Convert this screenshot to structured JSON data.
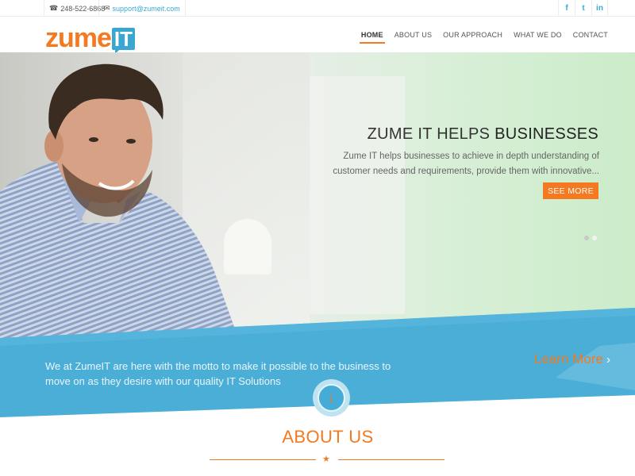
{
  "topbar": {
    "phone": "248-522-6868",
    "email": "support@zumeit.com",
    "phone_icon": "phone-icon",
    "email_icon": "envelope-icon",
    "social": [
      {
        "name": "facebook-icon",
        "glyph": "f"
      },
      {
        "name": "twitter-icon",
        "glyph": "t"
      },
      {
        "name": "linkedin-icon",
        "glyph": "in"
      }
    ]
  },
  "logo": {
    "part1": "zume",
    "part2": "IT"
  },
  "nav": {
    "items": [
      "HOME",
      "ABOUT US",
      "OUR APPROACH",
      "WHAT WE DO",
      "CONTACT"
    ],
    "active": "HOME"
  },
  "hero": {
    "title_light": "ZUME IT HELPS ",
    "title_bold": "BUSINESSES",
    "text": "Zume IT helps businesses to achieve in depth understanding of customer needs and requirements, provide them with innovative...",
    "button": "SEE MORE",
    "slide_count": 2,
    "active_slide": 2
  },
  "band": {
    "text": "We at ZumeIT are here with the motto to make it possible to the business to move on as they desire with our quality IT Solutions",
    "learn_more": "Learn More",
    "learn_more_chevron": "›",
    "down_icon": "↓"
  },
  "about": {
    "title": "ABOUT US",
    "star": "★"
  },
  "colors": {
    "accent": "#f47920",
    "brand_blue": "#3aa7d3",
    "band_blue": "#4aaed6"
  }
}
